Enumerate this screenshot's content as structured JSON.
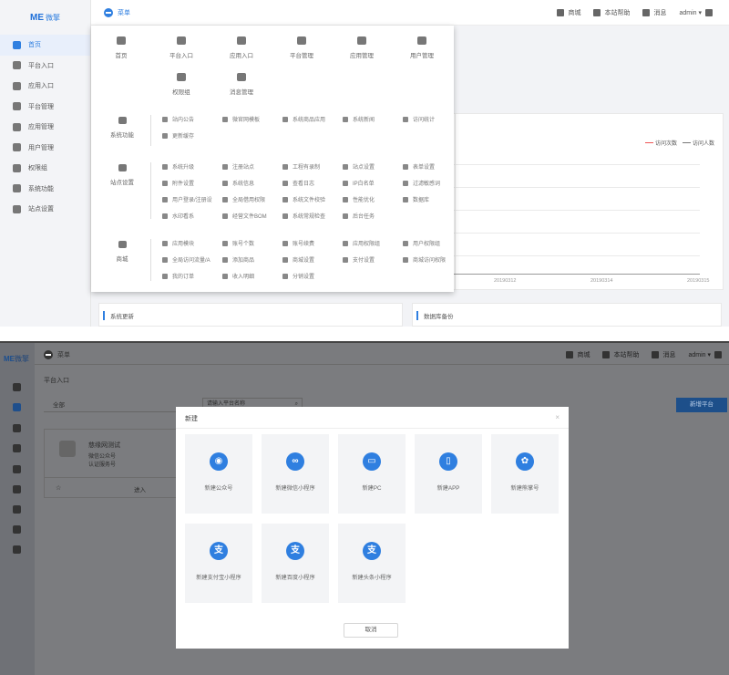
{
  "top": {
    "logo": {
      "mark": "ME",
      "name": "微擎"
    },
    "menu_label": "菜单",
    "topbar": [
      "商城",
      "本站帮助",
      "消息",
      "admin ▾"
    ],
    "sidebar": [
      "首页",
      "平台入口",
      "应用入口",
      "平台管理",
      "应用管理",
      "用户管理",
      "权限组",
      "系统功能",
      "站点设置"
    ],
    "quick_row1": [
      "首页",
      "平台入口",
      "应用入口",
      "平台管理",
      "应用管理",
      "用户管理"
    ],
    "quick_row2": [
      "权限组",
      "消息管理"
    ],
    "sections": [
      {
        "title": "系统功能",
        "items": [
          "站内公告",
          "微官网模板",
          "系统商品应用",
          "系统新闻",
          "访问统计",
          "更新缓存"
        ]
      },
      {
        "title": "站点设置",
        "items": [
          "系统升级",
          "注册站点",
          "工程有录制",
          "站点设置",
          "表单设置",
          "附件设置",
          "系统信息",
          "查看日志",
          "IP白名单",
          "过滤敏感词",
          "用户登录/注册设",
          "全局借用权限",
          "系统文件校验",
          "性能优化",
          "数据库",
          "水印看系",
          "经营文件BOM",
          "系统常规检查",
          "后台任务"
        ]
      },
      {
        "title": "商城",
        "items": [
          "应用模块",
          "账号个数",
          "账号续费",
          "应用权限组",
          "用户权限组",
          "全局访问流量/A",
          "添加商品",
          "商城设置",
          "支付设置",
          "商城访问权限",
          "我的订单",
          "收入明细",
          "分销设置"
        ]
      }
    ],
    "legend": [
      "访问次数",
      "访问人数"
    ],
    "x_labels": [
      "20190312",
      "20190314",
      "20190315"
    ],
    "panels": [
      "系统更新",
      "数据库备份"
    ]
  },
  "bottom": {
    "logo": {
      "mark": "ME",
      "name": "微擎"
    },
    "menu_label": "菜单",
    "topbar": [
      "商城",
      "本站帮助",
      "消息",
      "admin ▾"
    ],
    "page_title": "平台入口",
    "filter_label": "全部",
    "search_placeholder": "请输入平台名称",
    "new_button": "新增平台",
    "card": {
      "name": "慈缘网测试",
      "line1": "微信公众号",
      "line2": "认证服务号",
      "star": "☆",
      "enter": "进入"
    },
    "modal": {
      "title": "新建",
      "close": "×",
      "cancel": "取消",
      "tiles": [
        {
          "label": "新建公众号",
          "icon": "wechat-icon",
          "glyph": "◉"
        },
        {
          "label": "新建微信小程序",
          "icon": "mini-program-icon",
          "glyph": "∞"
        },
        {
          "label": "新建PC",
          "icon": "pc-monitor-icon",
          "glyph": "▭"
        },
        {
          "label": "新建APP",
          "icon": "mobile-app-icon",
          "glyph": "▯"
        },
        {
          "label": "新建熊掌号",
          "icon": "baidu-paw-icon",
          "glyph": "✿"
        },
        {
          "label": "新建支付宝小程序",
          "icon": "alipay-icon",
          "glyph": "支"
        },
        {
          "label": "新建百度小程序",
          "icon": "alipay-icon",
          "glyph": "支"
        },
        {
          "label": "新建头条小程序",
          "icon": "alipay-icon",
          "glyph": "支"
        }
      ]
    }
  },
  "colors": {
    "accent": "#2f7fe0",
    "overlay": "#7d7d7d"
  }
}
